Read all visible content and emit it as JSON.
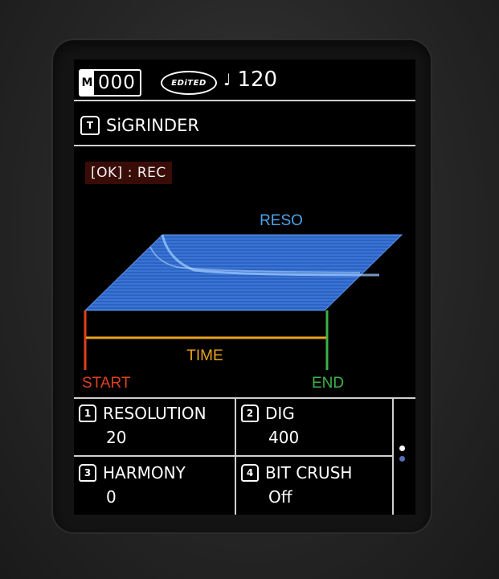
{
  "header": {
    "mode_letter": "M",
    "patch_number": "000",
    "edited_badge": "EDiTED",
    "tempo_icon": "quarter-note-icon",
    "tempo_value": "120"
  },
  "patch": {
    "icon": "T",
    "name": "SiGRINDER"
  },
  "action_hint": "[OK] : REC",
  "graph": {
    "top_label": "RESO",
    "mid_label": "TIME",
    "start_label": "START",
    "end_label": "END",
    "colors": {
      "plane": "#3c78d8",
      "start": "#e0401e",
      "time": "#e8a21b",
      "end": "#3fb24a",
      "reso": "#4aa3e8"
    }
  },
  "params": [
    {
      "knob": "1",
      "label": "RESOLUTION",
      "value": "20"
    },
    {
      "knob": "2",
      "label": "DIG",
      "value": "400"
    },
    {
      "knob": "3",
      "label": "HARMONY",
      "value": "0"
    },
    {
      "knob": "4",
      "label": "BIT CRUSH",
      "value": "Off"
    }
  ]
}
